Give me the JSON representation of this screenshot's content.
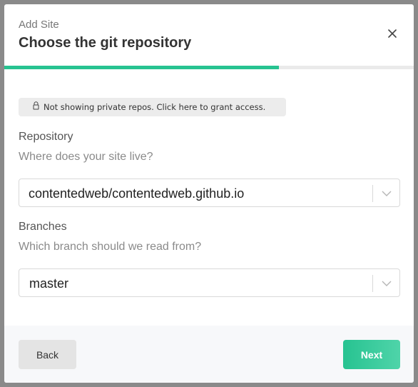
{
  "header": {
    "subtitle": "Add Site",
    "title": "Choose the git repository"
  },
  "progress": {
    "fraction": 0.67,
    "color": "#27c391"
  },
  "notice": {
    "icon": "lock-icon",
    "text": "Not showing private repos. Click here to grant access."
  },
  "repository": {
    "label": "Repository",
    "hint": "Where does your site live?",
    "selected": "contentedweb/contentedweb.github.io"
  },
  "branches": {
    "label": "Branches",
    "hint": "Which branch should we read from?",
    "selected": "master"
  },
  "footer": {
    "back_label": "Back",
    "next_label": "Next"
  },
  "colors": {
    "accent": "#27c391",
    "accent_light": "#4fd4a9"
  }
}
